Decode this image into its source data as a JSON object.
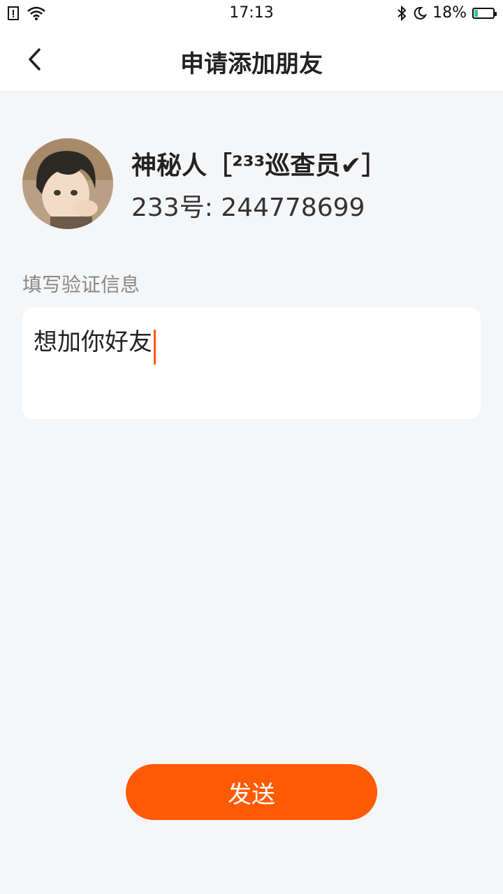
{
  "status_bar": {
    "time": "17:13",
    "battery_percent": "18%",
    "battery_level": 0.18,
    "icons": [
      "sim-alert-icon",
      "wifi-icon",
      "bluetooth-icon",
      "moon-icon",
      "battery-charging-icon"
    ]
  },
  "header": {
    "title": "申请添加朋友",
    "back_icon": "chevron-left-icon"
  },
  "profile": {
    "name": "神秘人［²³³巡查员✔］",
    "id_text": "233号: 244778699"
  },
  "verification": {
    "label": "填写验证信息",
    "value": "想加你好友"
  },
  "actions": {
    "send_label": "发送"
  },
  "colors": {
    "accent": "#ff5a05",
    "background": "#f5f6f8",
    "battery": "#35c78a"
  }
}
